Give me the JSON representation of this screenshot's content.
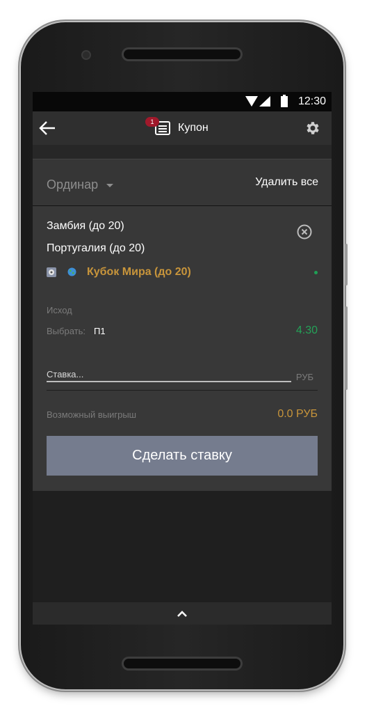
{
  "status_bar": {
    "time": "12:30"
  },
  "app_bar": {
    "title": "Купон",
    "badge_count": "1",
    "icons": {
      "back": "arrow-left-icon",
      "coupon": "coupon-list-icon",
      "settings": "gear-icon"
    }
  },
  "bet_panel": {
    "bet_type": "Ординар",
    "delete_all": "Удалить все"
  },
  "bet_card": {
    "team_1": "Замбия (до 20)",
    "team_2": "Португалия (до 20)",
    "tournament": "Кубок Мира (до 20)",
    "outcome_label": "Исход",
    "pick_label": "Выбрать:",
    "pick_value": "П1",
    "odds": "4.30",
    "stake_placeholder": "Ставка...",
    "stake_currency": "РУБ",
    "possible_win_label": "Возможный выигрыш",
    "possible_win_value": "0.0 РУБ",
    "submit_label": "Сделать ставку"
  },
  "colors": {
    "accent_gold": "#c8953b",
    "odds_green": "#24a258",
    "badge_red": "#a0192b",
    "button_gray": "#757c8e"
  }
}
